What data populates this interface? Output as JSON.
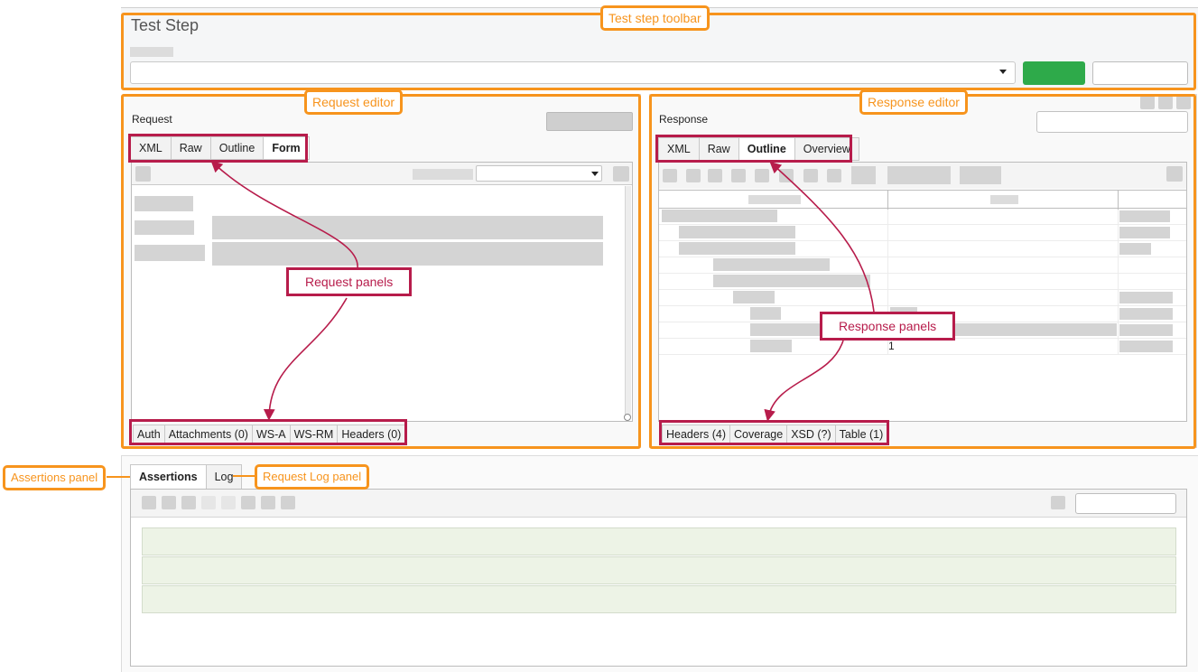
{
  "toolbar": {
    "title": "Test Step",
    "run_button_color": "#2eaa4a"
  },
  "request": {
    "heading": "Request",
    "tabs": [
      "XML",
      "Raw",
      "Outline",
      "Form"
    ],
    "active_tab": "Form",
    "bottom_tabs": [
      "Auth",
      "Attachments (0)",
      "WS-A",
      "WS-RM",
      "Headers (0)"
    ]
  },
  "response": {
    "heading": "Response",
    "tabs": [
      "XML",
      "Raw",
      "Outline",
      "Overview"
    ],
    "active_tab": "Outline",
    "bottom_tabs": [
      "Headers (4)",
      "Coverage",
      "XSD (?)",
      "Table (1)"
    ],
    "outline_value": "1"
  },
  "assertions": {
    "tabs": [
      "Assertions",
      "Log"
    ],
    "active_tab": "Assertions",
    "row_color": "#edf3e6"
  },
  "annotations": {
    "test_step_toolbar": "Test step toolbar",
    "request_editor": "Request editor",
    "response_editor": "Response editor",
    "request_panels": "Request panels",
    "response_panels": "Response panels",
    "assertions_panel": "Assertions panel",
    "request_log_panel": "Request Log panel"
  },
  "colors": {
    "annotation_orange": "#f7941d",
    "annotation_red": "#b71c4b"
  }
}
